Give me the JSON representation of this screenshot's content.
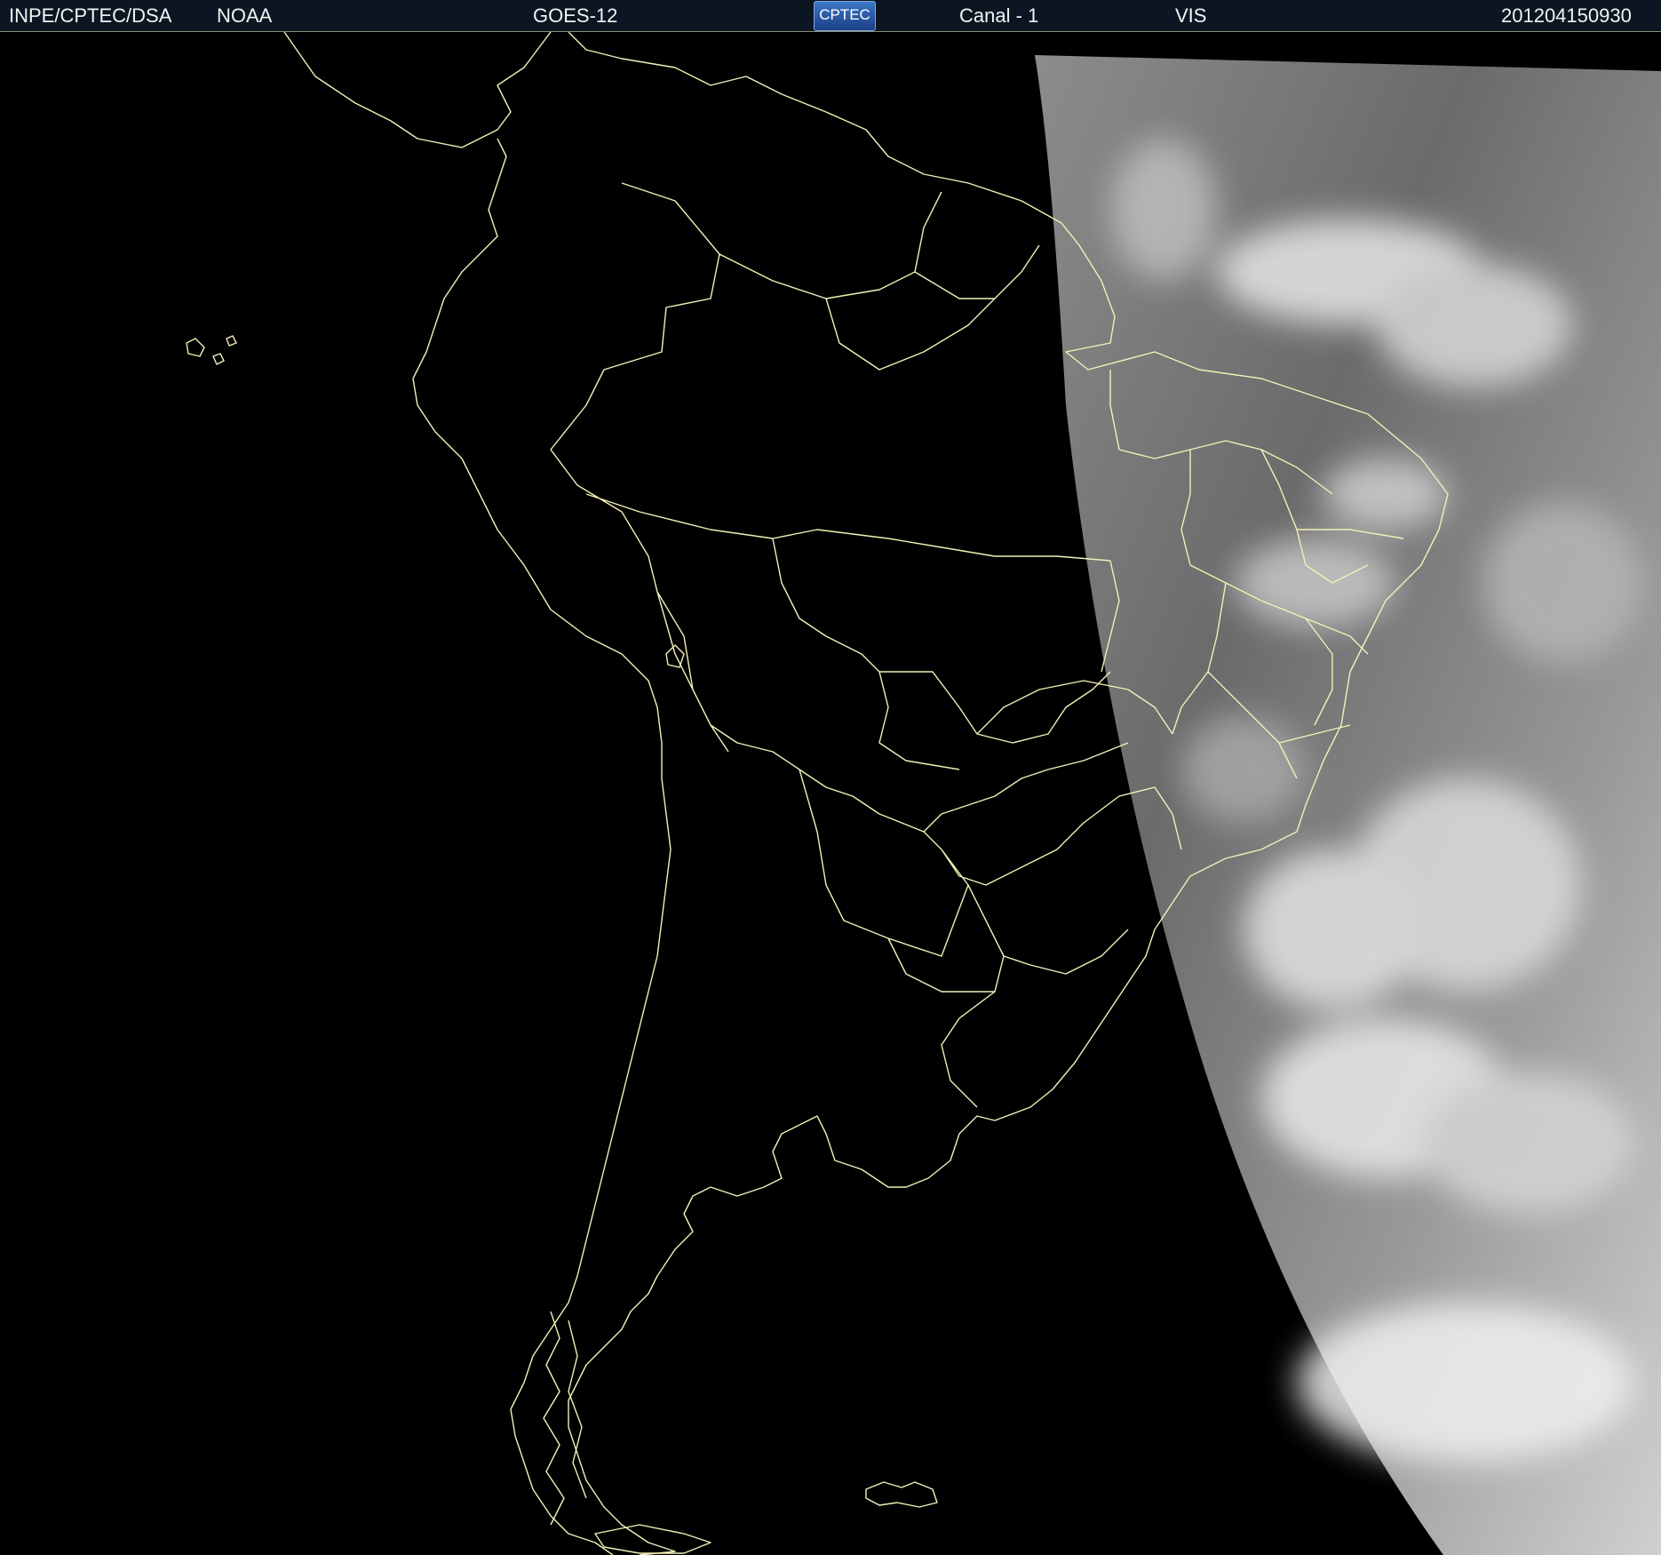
{
  "header": {
    "institution": "INPE/CPTEC/DSA",
    "agency": "NOAA",
    "satellite": "GOES-12",
    "logo_text": "CPTEC",
    "channel": "Canal - 1",
    "band": "VIS",
    "timestamp": "201204150930"
  },
  "map": {
    "region": "South America",
    "imagery": "visible satellite imagery (night side unlit)",
    "border_color": "#f3f0b8",
    "background_color": "#000000"
  }
}
